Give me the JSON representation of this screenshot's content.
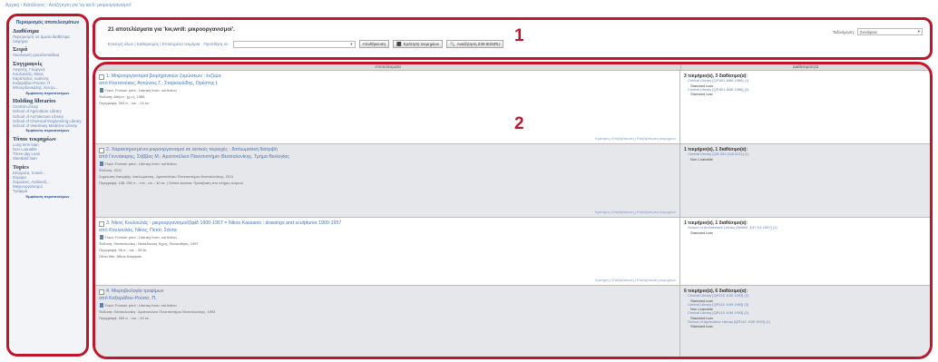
{
  "breadcrumb": "Αρχική › Κατάλογος › Αναζήτηση για 'su:arch: μικροοργανισμοί'",
  "sidebar": {
    "refine": "Περιορισμός αποτελεσμάτων",
    "groups": [
      {
        "title": "Διαθέσιμα",
        "items": [
          "Περιορισμός σε άμεσα διαθέσιμα τεκμήρια"
        ],
        "more": ""
      },
      {
        "title": "Σειρά",
        "items": [
          "Οικολογική εγκυκλοπαίδεια"
        ],
        "more": ""
      },
      {
        "title": "Συγγραφείς",
        "items": [
          "Αυγενής, Γεώργιος",
          "Κουλουλάς, Νίκος",
          "Καράπατας, Ιωάννης",
          "Κοξαράδου-Ρούσσ, Π.",
          "Μπουρδουκάλης, Κεντρι..."
        ],
        "more": "Εμφάνιση περισσοτέρων"
      },
      {
        "title": "Holding libraries",
        "items": [
          "Central Library",
          "School of Agriculture Library",
          "School of Architecture Library",
          "School of Chemical Engineering Library",
          "School of Veterinary Medicine Library"
        ],
        "more": "Εμφάνιση περισσοτέρων"
      },
      {
        "title": "Τύποι τεκμηρίων",
        "items": [
          "Long term loan",
          "Non Loanable",
          "Three day Loan",
          "Standard loan"
        ],
        "more": ""
      },
      {
        "title": "Topics",
        "items": [
          "Ζεύγματα, πυκνά...",
          "Ζύμαρα",
          "Ζυμώσεις, Ανάλυσή...",
          "Μικροοργανισμοί",
          "Τρόφιμα"
        ],
        "more": "Εμφάνιση περισσοτέρων"
      }
    ]
  },
  "top": {
    "title": "21 αποτελέσματα για 'kw,wrdl: μικροοργανισμοί'.",
    "select_all": "Επιλογή όλων | Καθαρισμός | Επιλεγμένα τεκμήρια",
    "add_to_select": "Προσθήκη σε:",
    "save_button": "Αποθήκευση",
    "hold_button": "Κράτηση τεκμηρίων",
    "z3950_button": "Αναζήτηση Z39.50/SRU",
    "sort_label": "Ταξινόμηση:",
    "sort_value": "Συνάφεια"
  },
  "markers": [
    "1",
    "2"
  ],
  "table": {
    "headers": [
      "Αποτελέσματα",
      "Διαθεσιμότητα"
    ],
    "rows": [
      {
        "title": "1. Μικροοργανισμοί βιομηχανικών ζυμώσεων : ένζυμα",
        "author": "από Κουτσούκος, Αντώνιος Γ.; Σταμκουλίδης, Ορέστης Ι.",
        "material": "Υλικό: Format: print ; Literary form: not fiction",
        "edition": "Έκδοση: Αθήνα : [χ.ε.], 1986",
        "description": "Περιγραφή: 303 σ. : εικ. ; 24 εκ.",
        "extra": "",
        "actions": "Κράτηση | Επιβεβαίωση | Επιβεβαίωση τεκμηρίων",
        "avail": "3 τεκμήριο(α), 3 διαθέσιμο(α):",
        "copies": [
          {
            "lib": "Central Library [QP.601.M66 1986] (1)",
            "status": "Standard loan"
          },
          {
            "lib": "Central Library [QP.601.M66 1986] (2)",
            "status": "Standard loan"
          }
        ]
      },
      {
        "title": "2. Χαρακτηρισμένοι μικροοργανισμοί σε αστικές περιοχές : διπλωματική διατριβή",
        "author": "από Γεννάκαρης, Σάββας Μ.; Αριστοτέλειο Πανεπιστήμιο Θεσσαλονίκης. Τμήμα Βιολογίας",
        "material": "Υλικό: Format: print ; Literary form: not fiction",
        "edition": "Έκδοση: 2011",
        "description": "Σημείωση διατριβής: Διπλωματική - Αριστοτέλειο Πανεπιστήμιο Θεσσαλονίκης, 2011",
        "extra": "Περιγραφή: 138, 252 σ. : πίν., εικ. ; 30 εκ. | Online Access: Πρόσβαση στο πλήρες κείμενο",
        "actions": "Κράτηση | Επιβεβαίωση | Επιβεβαίωση τεκμηρίων",
        "avail": "1 τεκμήριο(α), 1 διαθέσιμο(α):",
        "copies": [
          {
            "lib": "Central Library [QR.001.G45 2011] (1)",
            "status": "Non Loanable"
          }
        ]
      },
      {
        "title": "3. Νίκος Κουλουλάς : μικροοργανισμοί/ζιφίδ 1900-1957 = Nikos Kassanis : drawings and sculptures 1900-1957",
        "author": "από Κουλουλάς, Νίκος; Πετσί, Σάντα",
        "material": "Υλικό: Format: print ; Literary form: not fiction",
        "edition": "Έκδοση: Θεσσαλονίκη : Μακεδονική Τέχνη, Πινακοθήκη, 1997",
        "description": "Περιγραφή: 96 σ. : εικ. ; 28 εκ.",
        "extra": "Other title: Nikos Kassanis",
        "actions": "Κράτηση | Επιβεβαίωση | Επιβεβαίωση τεκμηρίων",
        "avail": "1 τεκμήριο(α), 1 διαθέσιμο(α):",
        "copies": [
          {
            "lib": "School of Architecture Library [N6663 .K47 K4 1997] (1)",
            "status": "Standard loan"
          }
        ]
      },
      {
        "title": "4. Μικροβιολογία τροφίμων",
        "author": "από Κοξαράδου-Ρούσσ, Π.",
        "material": "Υλικό: Format: print ; Literary form: not fiction",
        "edition": "Έκδοση: Θεσσαλονίκη : Αριστοτέλειο Πανεπιστήμιο Θεσσαλονίκης, 1993",
        "description": "Περιγραφή: 263 σ. : εικ. ; 24 εκ.",
        "extra": "",
        "actions": "Κράτηση | Επιβεβαίωση | Επιβεβαίωση τεκμηρίων",
        "avail": "6 τεκμήριο(α), 6 διαθέσιμο(α):",
        "copies": [
          {
            "lib": "Central Library [QR115 .K69 1993] (2)",
            "status": "Standard loan"
          },
          {
            "lib": "Central Library [QR115 .K69 1993] (3)",
            "status": "Non Loanable"
          },
          {
            "lib": "Central Library [QR115 .K69 1993] (1)",
            "status": "Standard loan"
          },
          {
            "lib": "School of Agriculture Library [QR115 .K69 1993] (1)",
            "status": "Standard loan"
          }
        ]
      }
    ]
  }
}
